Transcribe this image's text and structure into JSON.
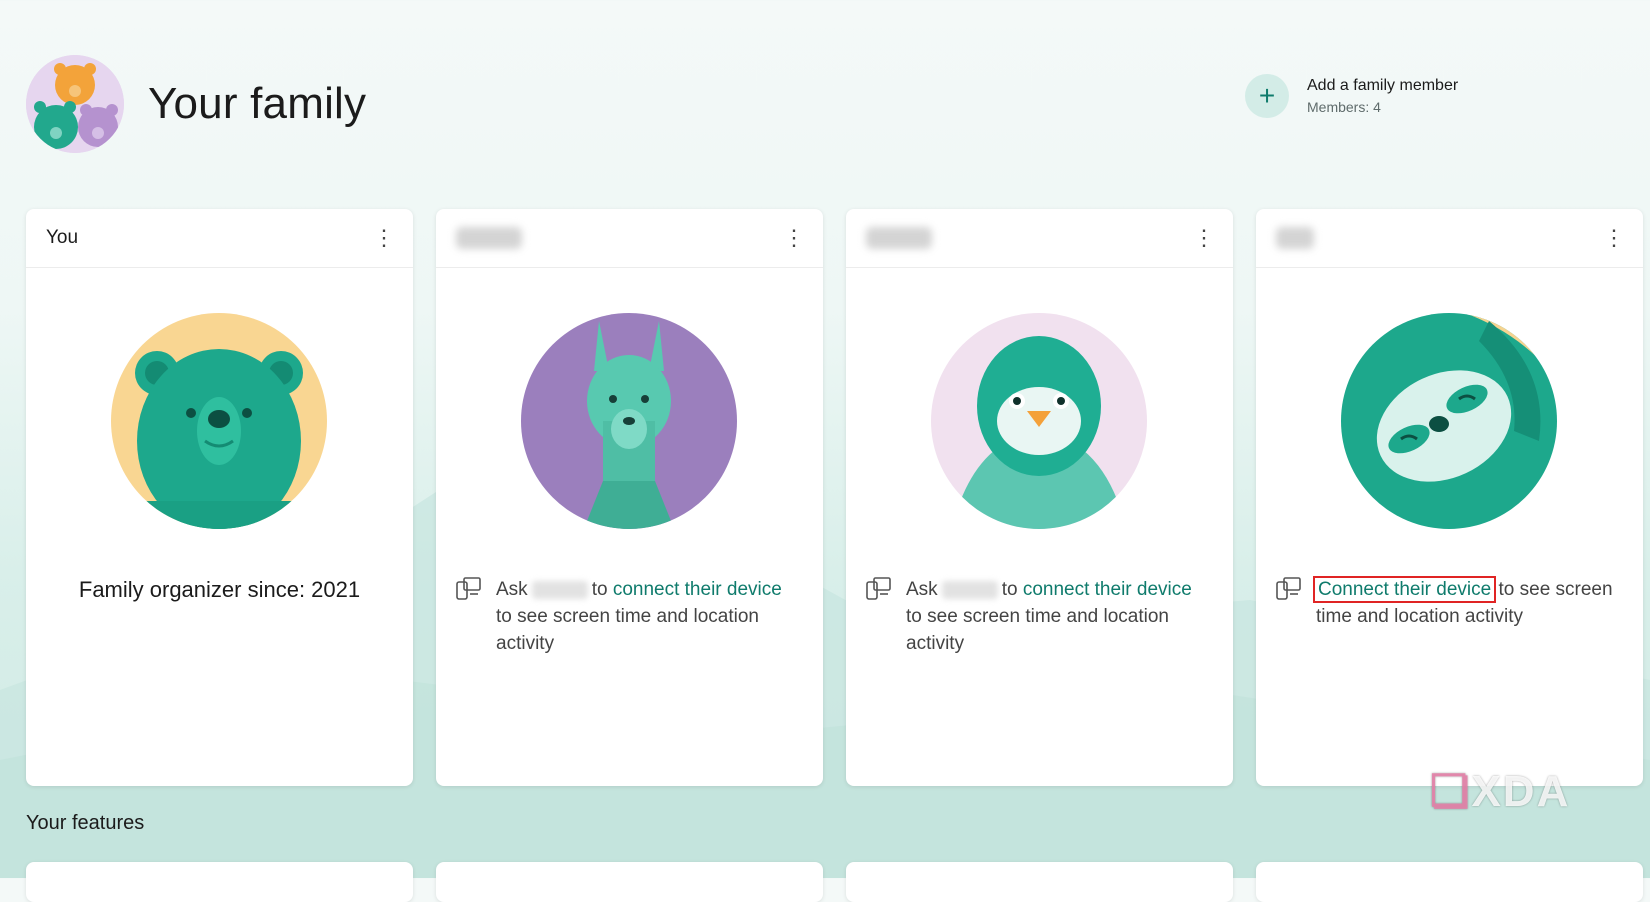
{
  "header": {
    "title": "Your family",
    "add_member_label": "Add a family member",
    "members_count": "Members: 4",
    "add_icon": "plus-icon"
  },
  "cards": [
    {
      "name": "You",
      "avatar": "bear",
      "organizer_text": "Family organizer since: 2021"
    },
    {
      "name": "",
      "avatar": "llama",
      "ask": "Ask",
      "link": "connect their device",
      "text_before_link": "to",
      "text_after": "to see screen time and location activity"
    },
    {
      "name": "",
      "avatar": "penguin",
      "ask": "Ask",
      "link": "connect their device",
      "text_before_link": "to",
      "text_after": "to see screen time and location activity"
    },
    {
      "name": "",
      "avatar": "sloth",
      "link": "Connect their device",
      "text_after": "to see screen time and location activity"
    }
  ],
  "features": {
    "title": "Your features"
  },
  "watermark": "XDA",
  "colors": {
    "accent": "#0f7b6c",
    "teal": "#2ab79a",
    "highlight_box": "#e02424"
  }
}
